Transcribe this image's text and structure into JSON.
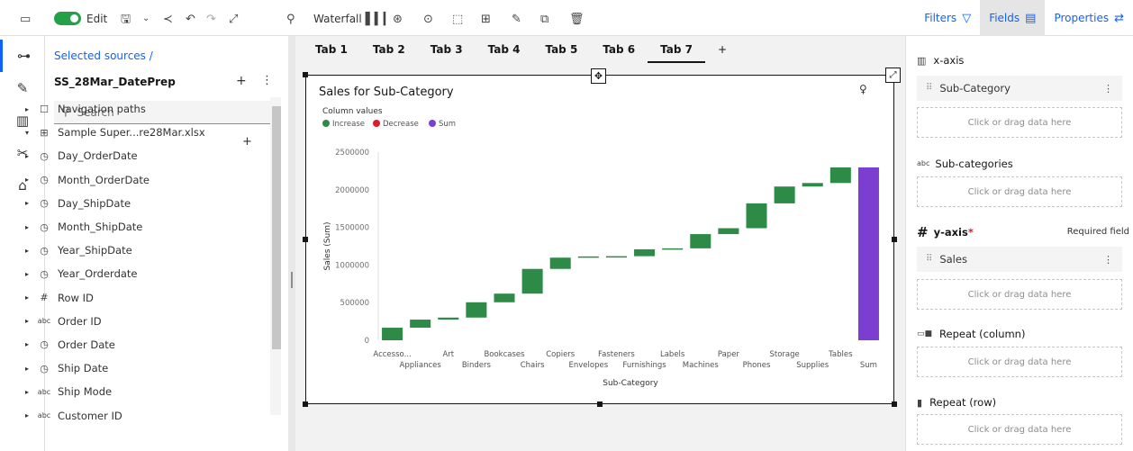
{
  "toolbar": {
    "edit_label": "Edit",
    "waterfall_label": "Waterfall",
    "filters_label": "Filters",
    "fields_label": "Fields",
    "properties_label": "Properties"
  },
  "sources": {
    "breadcrumb": "Selected sources  /",
    "name": "SS_28Mar_DatePrep",
    "search_placeholder": "Search",
    "items": [
      {
        "label": "Navigation paths",
        "icon": "folder-icon",
        "glyph": "☐",
        "caret": "▸"
      },
      {
        "label": "Sample Super...re28Mar.xlsx",
        "icon": "table-icon",
        "glyph": "⊞",
        "caret": "▾"
      },
      {
        "label": "Day_OrderDate",
        "icon": "clock-icon",
        "glyph": "◷",
        "caret": "▸"
      },
      {
        "label": "Month_OrderDate",
        "icon": "clock-icon",
        "glyph": "◷",
        "caret": "▸"
      },
      {
        "label": "Day_ShipDate",
        "icon": "clock-icon",
        "glyph": "◷",
        "caret": "▸"
      },
      {
        "label": "Month_ShipDate",
        "icon": "clock-icon",
        "glyph": "◷",
        "caret": "▸"
      },
      {
        "label": "Year_ShipDate",
        "icon": "clock-icon",
        "glyph": "◷",
        "caret": "▸"
      },
      {
        "label": "Year_Orderdate",
        "icon": "clock-icon",
        "glyph": "◷",
        "caret": "▸"
      },
      {
        "label": "Row ID",
        "icon": "hash-icon",
        "glyph": "#",
        "caret": "▸"
      },
      {
        "label": "Order ID",
        "icon": "abc-icon",
        "glyph": "abc",
        "caret": "▸"
      },
      {
        "label": "Order Date",
        "icon": "clock-icon",
        "glyph": "◷",
        "caret": "▸"
      },
      {
        "label": "Ship Date",
        "icon": "clock-icon",
        "glyph": "◷",
        "caret": "▸"
      },
      {
        "label": "Ship Mode",
        "icon": "abc-icon",
        "glyph": "abc",
        "caret": "▸"
      },
      {
        "label": "Customer ID",
        "icon": "abc-icon",
        "glyph": "abc",
        "caret": "▸"
      }
    ]
  },
  "tabs": [
    "Tab 1",
    "Tab 2",
    "Tab 3",
    "Tab 4",
    "Tab 5",
    "Tab 6",
    "Tab 7"
  ],
  "add_tab": "+",
  "fields": {
    "xaxis_label": "x-axis",
    "xaxis_item": "Sub-Category",
    "subcat_label": "Sub-categories",
    "yaxis_label": "y-axis",
    "yaxis_required_marker": "*",
    "required_field": "Required field",
    "yaxis_item": "Sales",
    "repeat_col_label": "Repeat (column)",
    "repeat_row_label": "Repeat (row)",
    "drop_hint": "Click or drag data here"
  },
  "colors": {
    "increase": "#2e8b47",
    "decrease": "#da1e28",
    "sum": "#7b3ed1",
    "accent": "#0f62fe"
  },
  "chart_data": {
    "type": "bar",
    "subtype": "waterfall",
    "title": "Sales for Sub-Category",
    "legend_title": "Column values",
    "legend": [
      "Increase",
      "Decrease",
      "Sum"
    ],
    "legend_position": "top-left",
    "xlabel": "Sub-Category",
    "ylabel": "Sales (Sum)",
    "ylim": [
      0,
      2500000
    ],
    "yticks": [
      0,
      500000,
      1000000,
      1500000,
      2000000,
      2500000
    ],
    "ytick_labels": [
      "0",
      "500000",
      "1000000",
      "1500000",
      "2000000",
      "2500000"
    ],
    "categories": [
      "Accesso...",
      "Appliances",
      "Art",
      "Binders",
      "Bookcases",
      "Chairs",
      "Copiers",
      "Envelopes",
      "Fasteners",
      "Furnishings",
      "Labels",
      "Machines",
      "Paper",
      "Phones",
      "Storage",
      "Supplies",
      "Tables",
      "Sum"
    ],
    "values": [
      167000,
      107500,
      27100,
      203400,
      114900,
      328400,
      149500,
      16500,
      3000,
      91700,
      12500,
      189200,
      78500,
      330000,
      223800,
      46700,
      206900,
      2297000
    ],
    "value_kind": [
      "increase",
      "increase",
      "increase",
      "increase",
      "increase",
      "increase",
      "increase",
      "increase",
      "increase",
      "increase",
      "increase",
      "increase",
      "increase",
      "increase",
      "increase",
      "increase",
      "increase",
      "sum"
    ]
  }
}
